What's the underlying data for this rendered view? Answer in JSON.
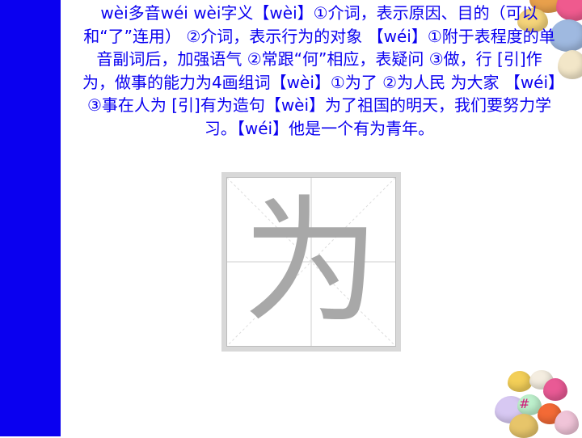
{
  "slide": {
    "body_text": "wèi多音wéi wèi字义【wèi】①介词，表示原因、目的（可以和“了”连用） ②介词，表示行为的对象 【wéi】①附于表程度的单音副词后，加强语气 ②常跟“何”相应，表疑问 ③做，行 [引]作为，做事的能力为4画组词【wèi】①为了 ②为人民 为大家 【wéi】③事在人为 [引]有为造句【wèi】为了祖国的明天，我们要努力学习。【wéi】他是一个有为青年。",
    "glyph": "为",
    "page_number": "#"
  },
  "colors": {
    "accent_blue": "#0a00f0",
    "glyph_gray": "#a8a8a8",
    "page_number_pink": "#d01a7a"
  }
}
